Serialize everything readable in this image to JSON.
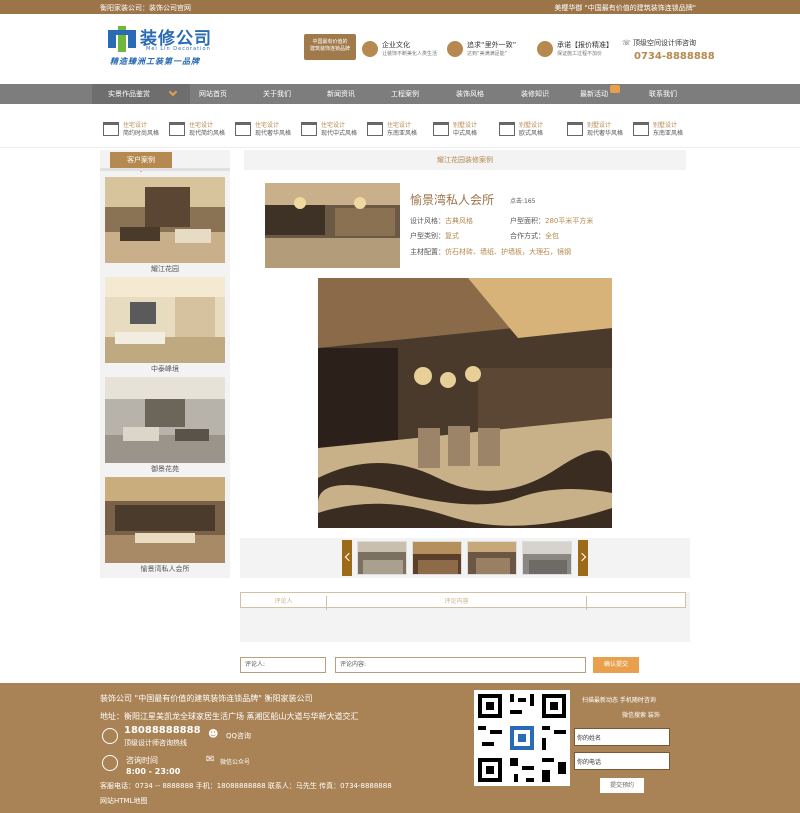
{
  "topbar": {
    "left": "衡阳家装公司：装饰公司官网",
    "right": "美樱华御 \"中国最有价值的建筑装饰连锁品牌\""
  },
  "logo": {
    "name": "装修公司",
    "english": "Mei Lin Decoration",
    "slogan": "精造臻洲工装第一品牌"
  },
  "header": {
    "badge_line1": "中国最有价值的",
    "badge_line2": "建筑装饰连锁品牌",
    "features": [
      {
        "title": "企业文化",
        "sub": "让装饰不断美化人类生活"
      },
      {
        "title": "追求“里外一致”",
        "sub": "达到“美满满足能”"
      },
      {
        "title": "承诺【报价精准】",
        "sub": "保证施工过程不加价"
      }
    ],
    "phone_label": "顶级空间设计师咨询",
    "phone": "0734-8888888"
  },
  "nav": {
    "items": [
      "实景作品鉴赏",
      "网站首页",
      "关于我们",
      "新闻资讯",
      "工程案例",
      "装饰风格",
      "装修知识",
      "最新活动",
      "联系我们"
    ]
  },
  "categories": [
    {
      "a": "住宅设计",
      "b": "简约时尚风格"
    },
    {
      "a": "住宅设计",
      "b": "现代简约风格"
    },
    {
      "a": "住宅设计",
      "b": "现代奢华风格"
    },
    {
      "a": "住宅设计",
      "b": "现代中式风格"
    },
    {
      "a": "住宅设计",
      "b": "东南亚风格"
    },
    {
      "a": "别墅设计",
      "b": "中式风格"
    },
    {
      "a": "别墅设计",
      "b": "欧式风格"
    },
    {
      "a": "别墅设计",
      "b": "现代奢华风格"
    },
    {
      "a": "别墅设计",
      "b": "东南亚风格"
    }
  ],
  "sidebar": {
    "title": "客户案例",
    "cases": [
      "耀江花园",
      "中泰峰境",
      "御景花苑",
      "愉景湾私人会所"
    ]
  },
  "project": {
    "section_title": "耀江花园装修案例",
    "title": "愉景湾私人会所",
    "clicks": "点击:165",
    "specs": [
      {
        "label": "设计风格：",
        "value": "古典风格"
      },
      {
        "label": "户型面积：",
        "value": "280平米平方米"
      },
      {
        "label": "户型类别：",
        "value": "复式"
      },
      {
        "label": "合作方式：",
        "value": "全包"
      },
      {
        "label": "主材配置：",
        "value": "仿石材砖、墙纸、护墙板，大理石，镜钢"
      }
    ]
  },
  "comments": {
    "col_person": "评论人",
    "col_content": "评论内容",
    "person_placeholder": "评论人:",
    "content_placeholder": "评论内容:",
    "submit": "确认提交"
  },
  "footer": {
    "line1": "装饰公司 \"中国最有价值的建筑装饰连锁品牌\" 衡阳家装公司",
    "address": "地址：衡阳江星美凯龙全球家居生活广场   蒸湘区船山大道与华新大道交汇",
    "hotline": "18088888888",
    "hotline_label": "顶级设计师咨询热线",
    "qq": "QQ咨询",
    "time_label": "咨询时间",
    "time": "8:00 - 23:00",
    "wechat": "微信公众号",
    "contacts": "客服电话：0734 -- 8888888 手机：18088888888    联系人：马先生    传真：0734-8888888",
    "sitemap": "网站HTML地图",
    "scan1": "扫描最新动态 手机随时咨询",
    "scan2": "微信搜索 装饰",
    "name_placeholder": "你的姓名",
    "phone_placeholder": "你的电话",
    "book": "提交预约"
  },
  "colors": {
    "brand": "#a98355",
    "accent": "#e8a04c",
    "nav": "#7d7d7d"
  }
}
